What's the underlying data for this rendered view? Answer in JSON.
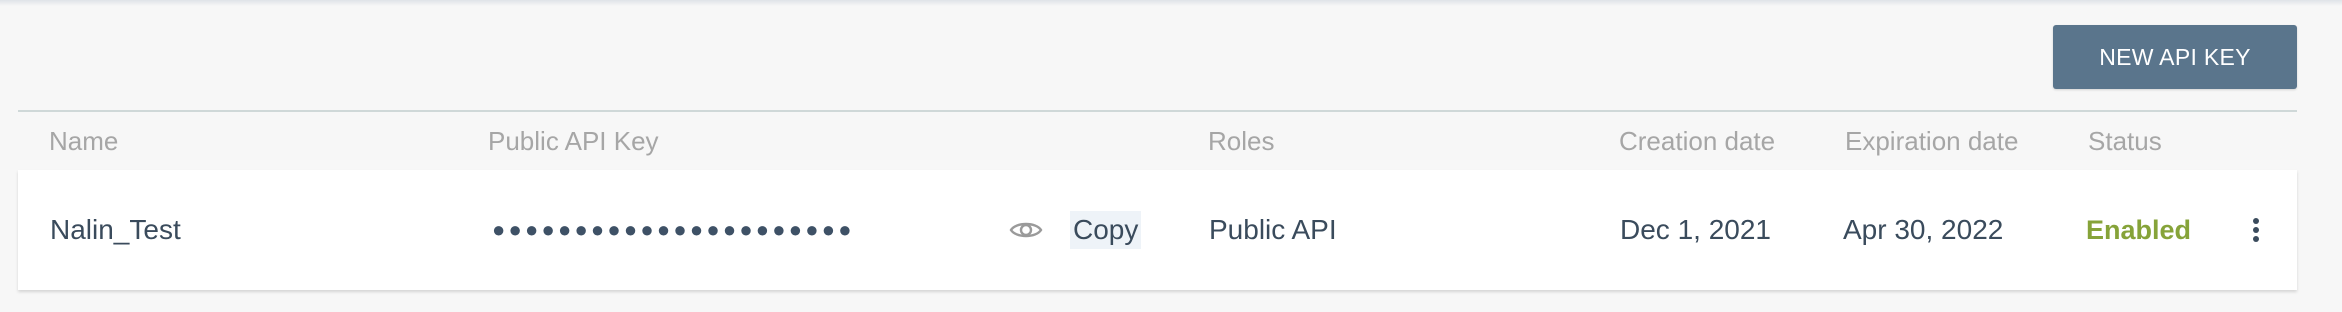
{
  "toolbar": {
    "new_key_label": "NEW API KEY"
  },
  "table": {
    "columns": {
      "name": "Name",
      "public_key": "Public API Key",
      "roles": "Roles",
      "creation_date": "Creation date",
      "expiration_date": "Expiration date",
      "status": "Status"
    },
    "rows": [
      {
        "name": "Nalin_Test",
        "public_key_masked": "●●●●●●●●●●●●●●●●●●●●●●",
        "copy_label": "Copy",
        "roles": "Public API",
        "creation_date": "Dec 1, 2021",
        "expiration_date": "Apr 30, 2022",
        "status": "Enabled"
      }
    ]
  },
  "icons": {
    "reveal": "eye-icon",
    "row_menu": "more-vertical-icon"
  },
  "colors": {
    "button_bg": "#5a758c",
    "status_enabled": "#86a339",
    "text": "#3a4b5c",
    "header_text": "#a6a6a6"
  }
}
